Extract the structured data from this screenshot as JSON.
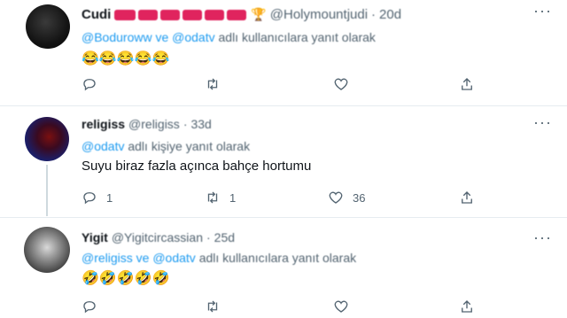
{
  "tweets": [
    {
      "name": "Cudi",
      "handle": "@Holymountjudi",
      "time": "20d",
      "reply_prefix": "",
      "reply_mentions": "@Boduroww ve @odatv",
      "reply_suffix": "adlı kullanıcılara yanıt olarak",
      "text": "😂😂😂😂😂",
      "reply_count": "",
      "retweet_count": "",
      "like_count": ""
    },
    {
      "name": "religiss",
      "handle": "@religiss",
      "time": "33d",
      "reply_mentions": "@odatv",
      "reply_suffix": "adlı kişiye yanıt olarak",
      "text": "Suyu biraz fazla açınca bahçe hortumu",
      "reply_count": "1",
      "retweet_count": "1",
      "like_count": "36"
    },
    {
      "name": "Yigit",
      "handle": "@Yigitcircassian",
      "time": "25d",
      "reply_mentions": "@religiss ve @odatv",
      "reply_suffix": "adlı kullanıcılara yanıt olarak",
      "text": "🤣🤣🤣🤣🤣",
      "reply_count": "",
      "retweet_count": "",
      "like_count": ""
    }
  ],
  "icons": {
    "reply": "reply-icon",
    "retweet": "retweet-icon",
    "like": "like-icon",
    "share": "share-icon",
    "more": "more-icon",
    "trophy": "trophy-icon"
  },
  "colors": {
    "mention": "#1d9bf0",
    "secondary_text": "#536471",
    "divider": "#e6ecf0",
    "redacted": "#e0245e"
  }
}
